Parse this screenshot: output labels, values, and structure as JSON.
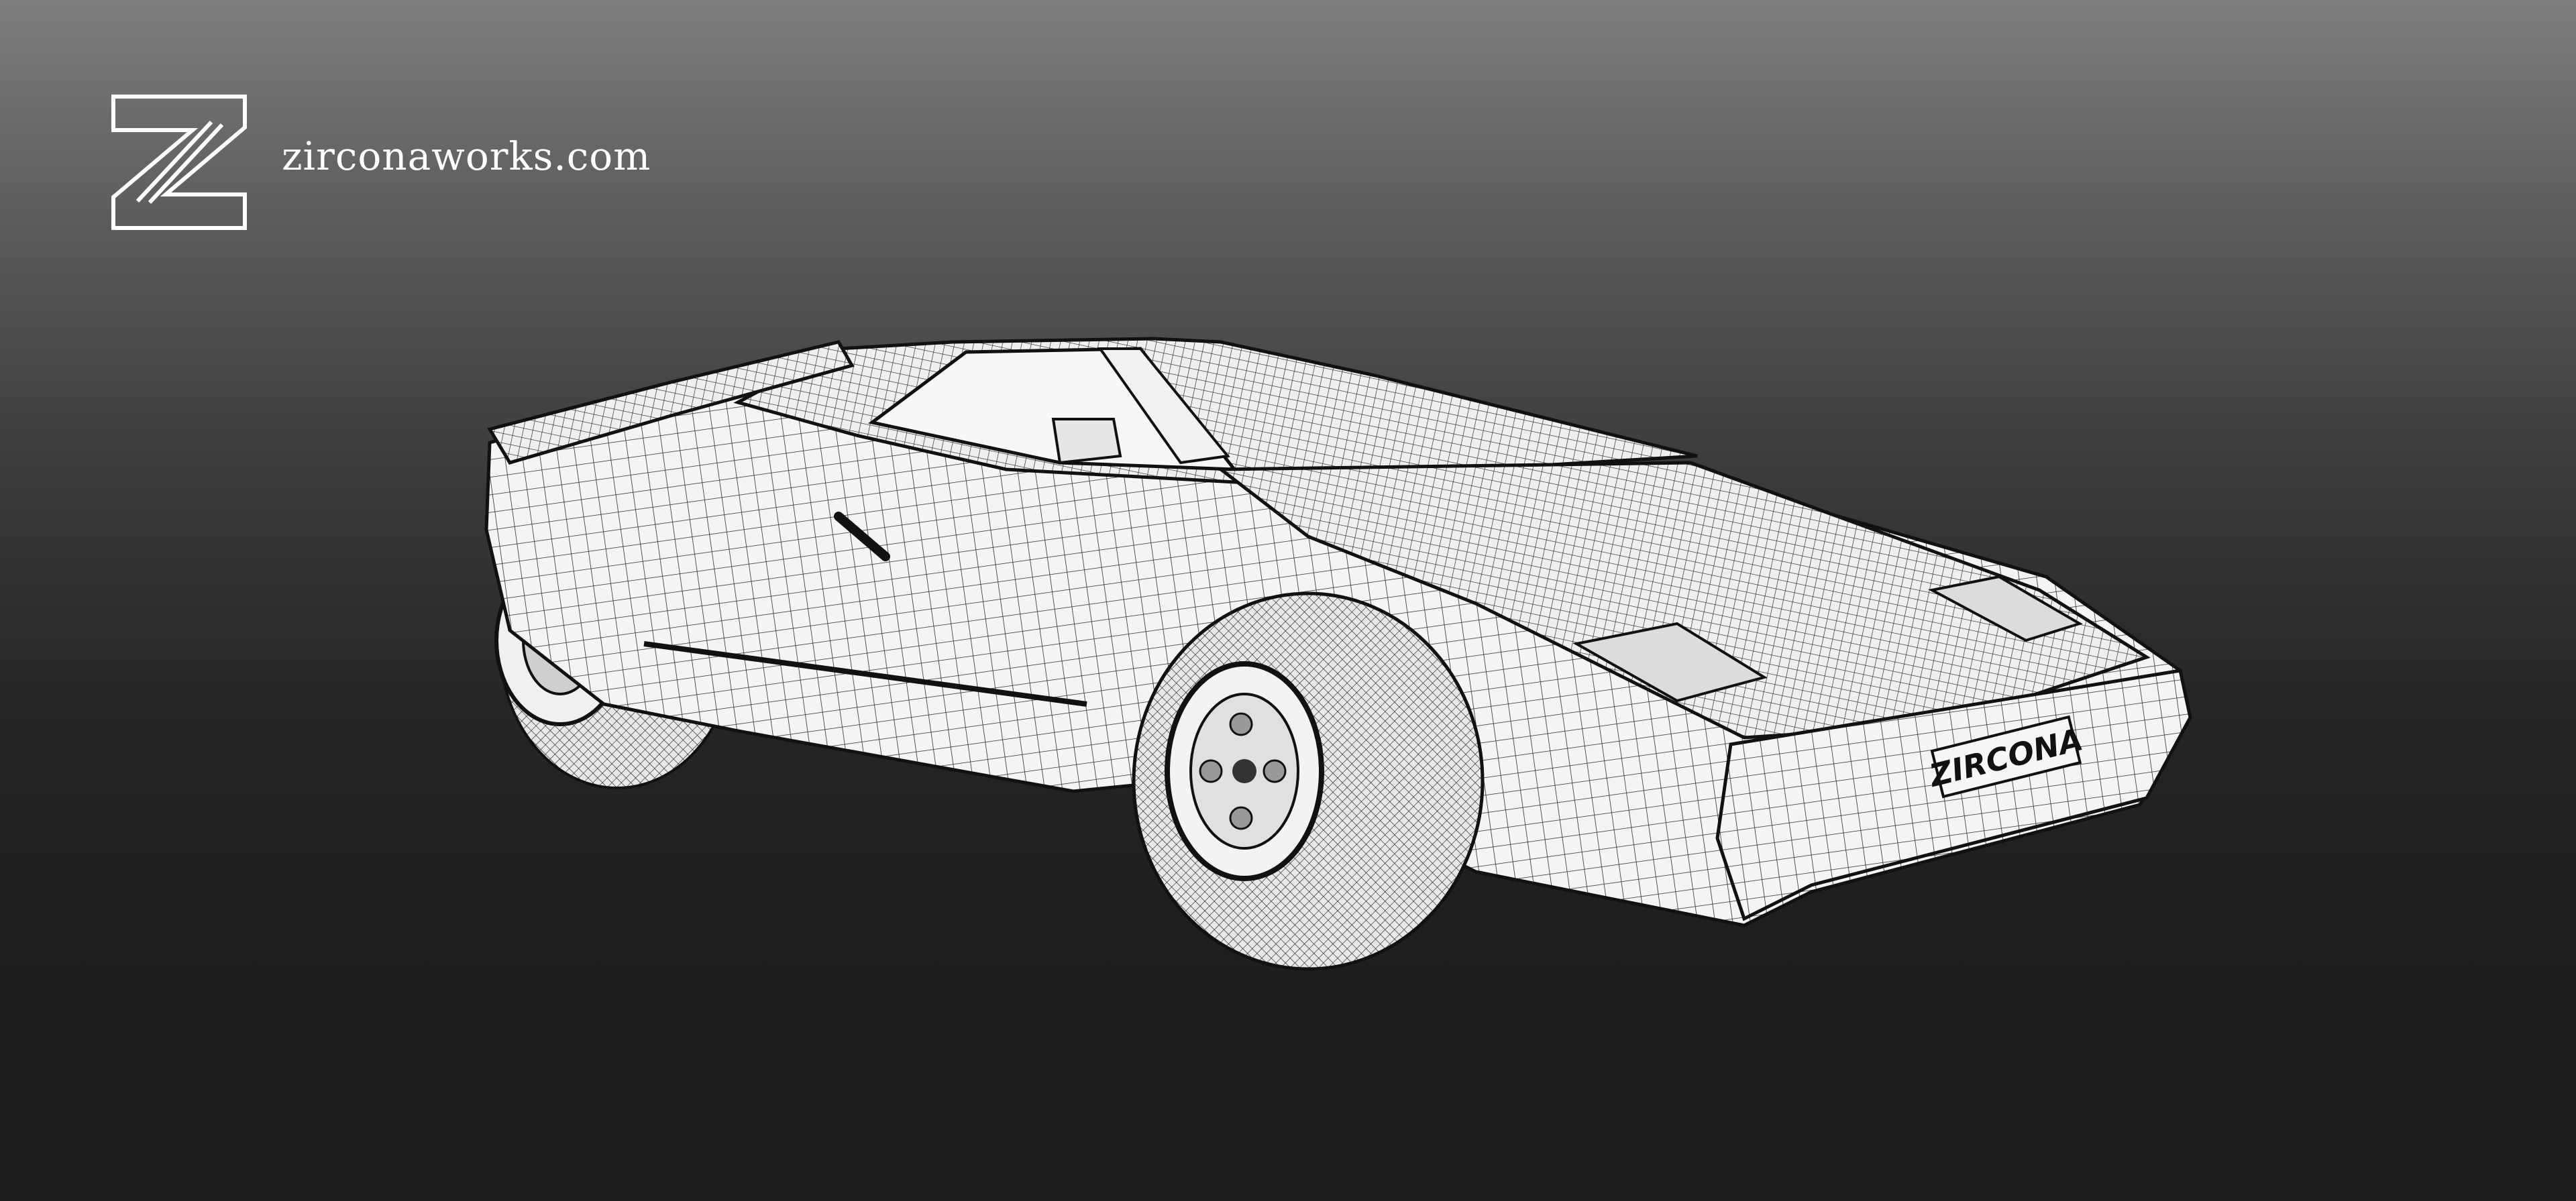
{
  "brand": {
    "website": "zirconaworks.com",
    "logo_letter": "Z",
    "logo_icon": "zircona-z-logo-icon"
  },
  "render": {
    "subject": "sports-car-wireframe",
    "license_plate": "ZIRCONA"
  },
  "colors": {
    "background_top": "#7e7e7e",
    "background_bottom": "#1d1d1d",
    "wire_fill": "#f4f4f4",
    "wire_line": "#1a1a1a",
    "logo_stroke": "#ffffff"
  }
}
